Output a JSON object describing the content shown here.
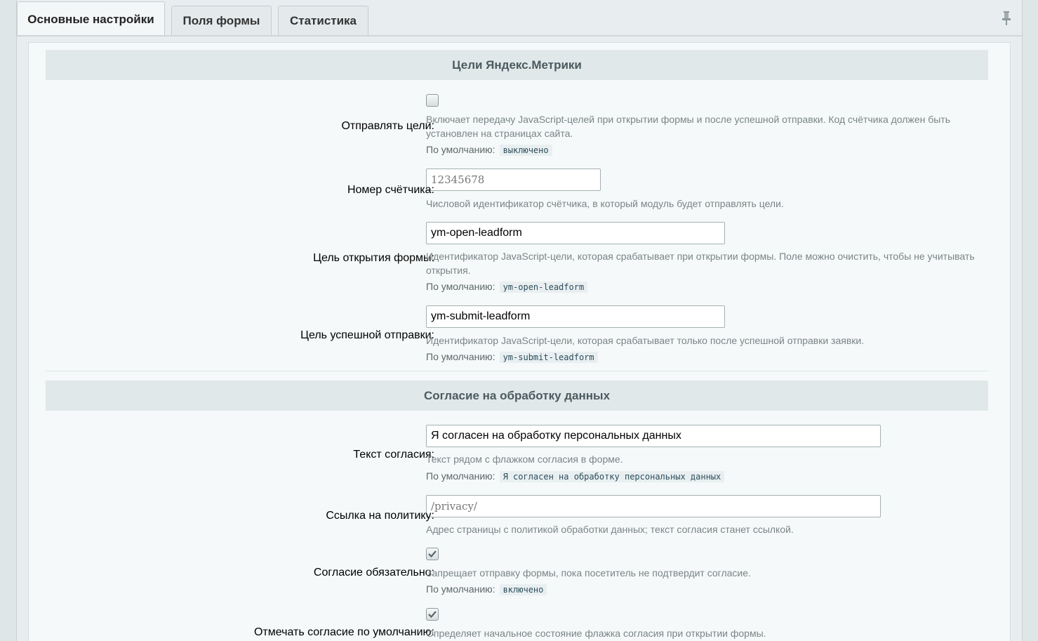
{
  "tabs": [
    {
      "label": "Основные настройки",
      "active": true
    },
    {
      "label": "Поля формы",
      "active": false
    },
    {
      "label": "Статистика",
      "active": false
    }
  ],
  "default_prefix": "По умолчанию:",
  "sections": {
    "metrika": {
      "title": "Цели Яндекс.Метрики",
      "send_goals": {
        "label": "Отправлять цели:",
        "checked": false,
        "hint": "Включает передачу JavaScript-целей при открытии формы и после успешной отправки. Код счётчика должен быть установлен на страницах сайта.",
        "default": "выключено"
      },
      "counter": {
        "label": "Номер счётчика:",
        "value": "",
        "placeholder": "12345678",
        "hint": "Числовой идентификатор счётчика, в который модуль будет отправлять цели."
      },
      "open_goal": {
        "label": "Цель открытия формы:",
        "value": "ym-open-leadform",
        "hint": "Идентификатор JavaScript-цели, которая срабатывает при открытии формы. Поле можно очистить, чтобы не учитывать открытия.",
        "default": "ym-open-leadform"
      },
      "submit_goal": {
        "label": "Цель успешной отправки:",
        "value": "ym-submit-leadform",
        "hint": "Идентификатор JavaScript-цели, которая срабатывает только после успешной отправки заявки.",
        "default": "ym-submit-leadform"
      }
    },
    "consent": {
      "title": "Согласие на обработку данных",
      "text": {
        "label": "Текст согласия:",
        "value": "Я согласен на обработку персональных данных",
        "hint": "Текст рядом с флажком согласия в форме.",
        "default": "Я согласен на обработку персональных данных"
      },
      "policy": {
        "label": "Ссылка на политику:",
        "value": "",
        "placeholder": "/privacy/",
        "hint": "Адрес страницы с политикой обработки данных; текст согласия станет ссылкой."
      },
      "required": {
        "label": "Согласие обязательно:",
        "checked": true,
        "hint": "Запрещает отправку формы, пока посетитель не подтвердит согласие.",
        "default": "включено"
      },
      "default_checked": {
        "label": "Отмечать согласие по умолчанию:",
        "checked": true,
        "hint": "Определяет начальное состояние флажка согласия при открытии формы."
      }
    }
  }
}
